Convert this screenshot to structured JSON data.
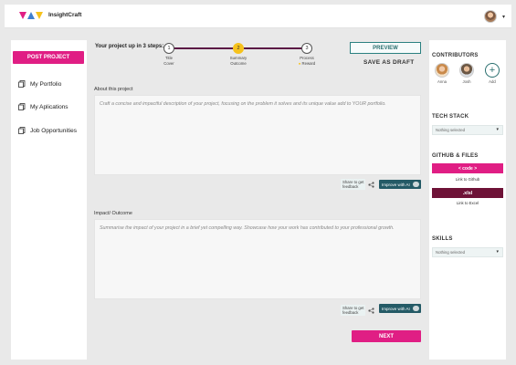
{
  "header": {
    "brand": "InsightCraft"
  },
  "left_nav": {
    "post_button": "POST PROJECT",
    "items": [
      {
        "label": "My Portfolio",
        "icon": "copy-icon"
      },
      {
        "label": "My Aplications",
        "icon": "copy-icon"
      },
      {
        "label": "Job Opportunities",
        "icon": "copy-icon"
      }
    ]
  },
  "steps": {
    "title": "Your project up in 3 steps:",
    "items": [
      {
        "num": "1",
        "label_top": "Title",
        "label_bottom": "Cover"
      },
      {
        "num": "2",
        "label_top": "Summary",
        "label_bottom": "Outcome"
      },
      {
        "num": "3",
        "label_top": "Process",
        "label_bottom": "Reward"
      }
    ]
  },
  "actions": {
    "preview": "PREVIEW",
    "save_draft": "SAVE AS DRAFT",
    "next": "NEXT"
  },
  "about": {
    "label": "About this project",
    "placeholder": "Craft a concise and impactful description of your project, focusing on the problem it solves and its unique value add to YOUR portfolio."
  },
  "impact": {
    "label": "Impact/ Outcome",
    "placeholder": "Summarise the impact of your project in a brief yet compelling way. Showcase how your work has contributed to your professional growth."
  },
  "feedback": {
    "share_line1": "Share to get",
    "share_line2": "feedback",
    "improve": "Improve with AI"
  },
  "right": {
    "contributors_title": "CONTRIBUTORS",
    "contributors": [
      {
        "name": "Anna"
      },
      {
        "name": "Josh"
      }
    ],
    "add_label": "Add",
    "tech_title": "TECH STACK",
    "tech_value": "Nothing selected",
    "github_title": "GITHUB & FILES",
    "code_btn": "< code >",
    "code_link": "Link to Github",
    "xlsl_btn": ".xlsl",
    "xlsl_link": "Link to Excel",
    "skills_title": "SKILLS",
    "skills_value": "Nothing selected"
  },
  "colors": {
    "accent": "#e01e84",
    "dark_accent": "#6e1237",
    "teal": "#245a66",
    "step_active": "#f6c21c"
  }
}
